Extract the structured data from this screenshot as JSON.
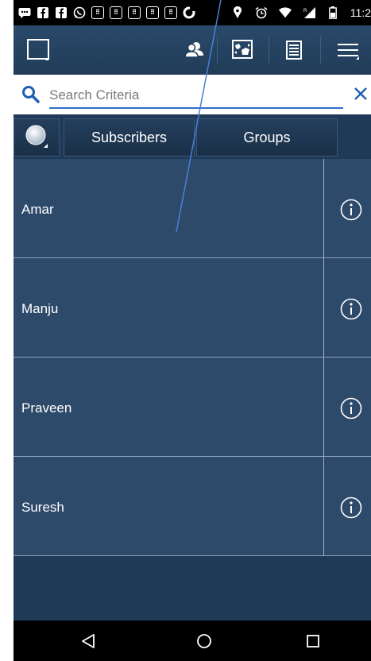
{
  "status_bar": {
    "time": "11:2",
    "notification_icons": [
      "chat-icon",
      "facebook-icon",
      "facebook-icon",
      "whatsapp-icon",
      "calendar-icon",
      "calendar-icon",
      "calendar-icon",
      "calendar-icon",
      "calendar-icon",
      "sync-icon"
    ],
    "system_icons": [
      "location-icon",
      "alarm-icon",
      "wifi-icon",
      "signal-icon",
      "battery-icon"
    ]
  },
  "action_bar": {
    "icons": [
      "select-box-icon",
      "contacts-icon",
      "map-icon",
      "list-icon",
      "menu-icon"
    ]
  },
  "search": {
    "placeholder": "Search Criteria",
    "search_icon": "search-icon",
    "clear_icon": "close-icon"
  },
  "tabs": {
    "toggle_icon": "circle-icon",
    "subscribers_label": "Subscribers",
    "groups_label": "Groups"
  },
  "contacts": [
    {
      "name": "Amar",
      "info_icon": "info-icon"
    },
    {
      "name": "Manju",
      "info_icon": "info-icon"
    },
    {
      "name": "Praveen",
      "info_icon": "info-icon"
    },
    {
      "name": "Suresh",
      "info_icon": "info-icon"
    }
  ],
  "nav_bar": {
    "icons": [
      "back-icon",
      "home-icon",
      "recents-icon"
    ]
  },
  "colors": {
    "app_background": "#1f3a57",
    "row_background": "#2e4a6a",
    "search_accent": "#2e6ec8",
    "pointer_line": "#4a7fd8"
  }
}
